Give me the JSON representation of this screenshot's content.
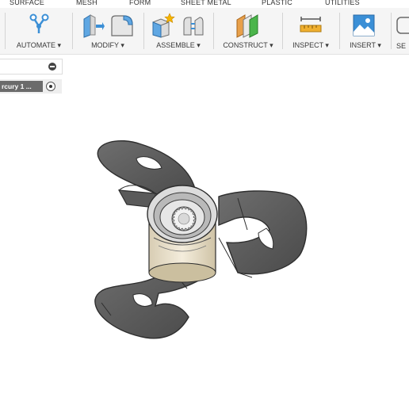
{
  "tabs": [
    "SURFACE",
    "MESH",
    "FORM",
    "SHEET METAL",
    "PLASTIC",
    "UTILITIES"
  ],
  "toolbar": {
    "groups": [
      {
        "label": "AUTOMATE ▾",
        "icon": "automate-icon"
      },
      {
        "label": "MODIFY ▾",
        "icons": [
          "press-pull-icon",
          "fillet-icon"
        ]
      },
      {
        "label": "ASSEMBLE ▾",
        "icons": [
          "new-component-icon",
          "joint-icon"
        ]
      },
      {
        "label": "CONSTRUCT ▾",
        "icon": "offset-plane-icon"
      },
      {
        "label": "INSPECT ▾",
        "icon": "measure-icon"
      },
      {
        "label": "INSERT ▾",
        "icon": "insert-image-icon"
      },
      {
        "label": "SE",
        "icon": "select-icon"
      }
    ]
  },
  "browser": {
    "component_label": "rcury 1 ..."
  },
  "colors": {
    "blade": "#5c5c5c",
    "blade_edge": "#2e2e2e",
    "hub": "#ece3cf",
    "accent_blue": "#3b8fd6"
  }
}
